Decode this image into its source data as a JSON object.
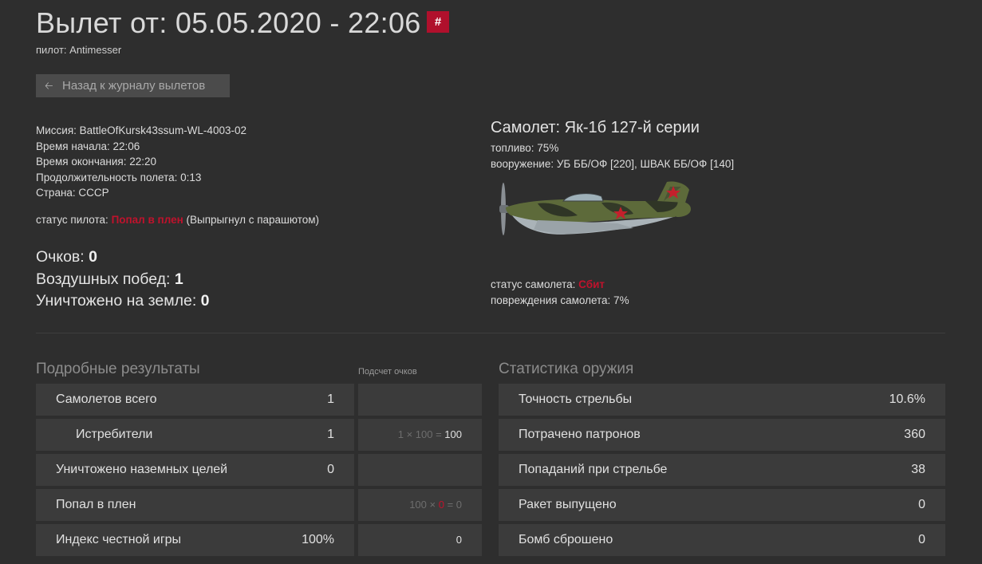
{
  "header": {
    "title": "Вылет от: 05.05.2020 - 22:06",
    "hash_label": "#",
    "pilot": "пилот: Antimesser"
  },
  "back_button": {
    "label": "Назад к журналу вылетов"
  },
  "mission_info": {
    "mission": "Миссия: BattleOfKursk43ssum-WL-4003-02",
    "start": "Время начала: 22:06",
    "end": "Время окончания: 22:20",
    "duration": "Продолжительность полета: 0:13",
    "country": "Страна: СССР"
  },
  "pilot_status": {
    "label": "статус пилота: ",
    "value": "Попал в плен",
    "note": " (Выпрыгнул с парашютом)"
  },
  "summary": {
    "points_label": "Очков:",
    "points": "0",
    "air_kills_label": "Воздушных побед:",
    "air_kills": "1",
    "ground_label": "Уничтожено на земле:",
    "ground": "0"
  },
  "aircraft": {
    "name": "Самолет: Як-1б 127-й серии",
    "fuel": "топливо: 75%",
    "weapons": "вооружение: УБ ББ/ОФ [220], ШВАК ББ/ОФ [140]",
    "status_label": "статус самолета: ",
    "status_value": "Сбит",
    "damage": "повреждения самолета: 7%"
  },
  "details": {
    "title": "Подробные результаты",
    "score_header": "Подсчет очков",
    "rows": [
      {
        "label": "Самолетов всего",
        "value": "1",
        "calc": ""
      },
      {
        "label": "Истребители",
        "value": "1",
        "calc_a": "1 × 100 = ",
        "calc_b": "100"
      },
      {
        "label": "Уничтожено наземных целей",
        "value": "0",
        "calc": ""
      },
      {
        "label": "Попал в плен",
        "value": "",
        "calc_a": "100 × ",
        "calc_red": "0",
        "calc_c": " = 0"
      },
      {
        "label": "Индекс честной игры",
        "value": "100%",
        "calc": "0"
      }
    ]
  },
  "weapons": {
    "title": "Статистика оружия",
    "rows": [
      {
        "label": "Точность стрельбы",
        "value": "10.6%"
      },
      {
        "label": "Потрачено патронов",
        "value": "360"
      },
      {
        "label": "Попаданий при стрельбе",
        "value": "38"
      },
      {
        "label": "Ракет выпущено",
        "value": "0"
      },
      {
        "label": "Бомб сброшено",
        "value": "0"
      }
    ]
  },
  "colors": {
    "accent": "#b0102c",
    "background": "#2e2e2e",
    "row": "#3b3b3b"
  }
}
